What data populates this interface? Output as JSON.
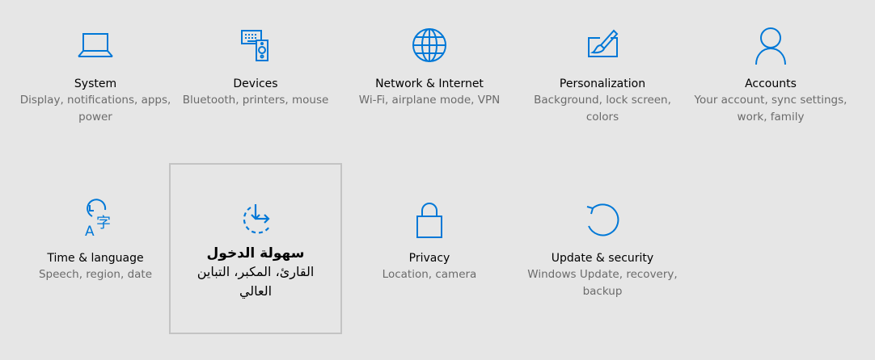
{
  "colors": {
    "background": "#e6e6e6",
    "accent": "#0078d7",
    "title_text": "#000000",
    "description_text": "#6b6b6b",
    "selection_border": "#c3c3c3"
  },
  "tiles": [
    {
      "icon": "laptop-icon",
      "title": "System",
      "description": "Display, notifications, apps, power"
    },
    {
      "icon": "devices-icon",
      "title": "Devices",
      "description": "Bluetooth, printers, mouse"
    },
    {
      "icon": "globe-icon",
      "title": "Network & Internet",
      "description": "Wi-Fi, airplane mode, VPN"
    },
    {
      "icon": "personalization-icon",
      "title": "Personalization",
      "description": "Background, lock screen, colors"
    },
    {
      "icon": "person-icon",
      "title": "Accounts",
      "description": "Your account, sync settings, work, family"
    },
    {
      "icon": "time-language-icon",
      "title": "Time & language",
      "description": "Speech, region, date"
    },
    {
      "icon": "ease-of-access-icon",
      "title": "سهولة الدخول",
      "description": "القارئ، المكبر، التباين العالي"
    },
    {
      "icon": "lock-icon",
      "title": "Privacy",
      "description": "Location, camera"
    },
    {
      "icon": "refresh-icon",
      "title": "Update & security",
      "description": "Windows Update, recovery, backup"
    }
  ]
}
